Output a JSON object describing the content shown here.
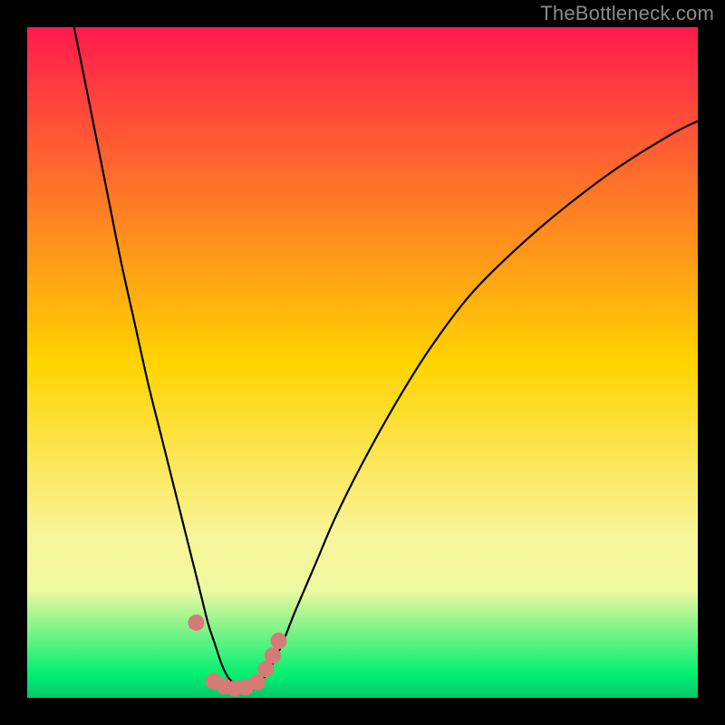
{
  "watermark": "TheBottleneck.com",
  "chart_data": {
    "type": "line",
    "title": "",
    "xlabel": "",
    "ylabel": "",
    "xlim": [
      0,
      100
    ],
    "ylim": [
      0,
      100
    ],
    "grid": false,
    "legend": false,
    "background_gradient": {
      "stops": [
        {
          "offset": 0.0,
          "color": "#ff1a4d"
        },
        {
          "offset": 0.5,
          "color": "#ffd400"
        },
        {
          "offset": 0.76,
          "color": "#f8f59a"
        },
        {
          "offset": 0.84,
          "color": "#edf8a0"
        },
        {
          "offset": 0.965,
          "color": "#00f070"
        },
        {
          "offset": 1.0,
          "color": "#00c86a"
        }
      ]
    },
    "series": [
      {
        "name": "bottleneck-curve",
        "color": "#000000",
        "x": [
          7,
          10,
          12,
          14,
          16,
          18,
          20,
          22,
          24,
          25,
          26,
          27,
          28,
          29,
          30,
          31,
          32,
          33,
          34,
          36,
          38,
          40,
          43,
          46,
          50,
          55,
          60,
          66,
          73,
          80,
          88,
          96,
          100
        ],
        "y": [
          100,
          85,
          75,
          65,
          56,
          47,
          39,
          31,
          23,
          19,
          15,
          11,
          8,
          5,
          3,
          2,
          1.3,
          1.2,
          1.5,
          4,
          8,
          13,
          20,
          27,
          35,
          44,
          52,
          60,
          67,
          73,
          79,
          84,
          86
        ]
      }
    ],
    "markers": {
      "name": "highlight-dots",
      "color": "#d57a74",
      "radius": 9,
      "points": [
        {
          "x": 25.2,
          "y": 11.2
        },
        {
          "x": 27.8,
          "y": 2.5
        },
        {
          "x": 29.4,
          "y": 1.7
        },
        {
          "x": 31.0,
          "y": 1.4
        },
        {
          "x": 32.6,
          "y": 1.6
        },
        {
          "x": 34.3,
          "y": 2.3
        },
        {
          "x": 35.6,
          "y": 4.3
        },
        {
          "x": 36.6,
          "y": 6.3
        },
        {
          "x": 37.5,
          "y": 8.5
        }
      ]
    }
  }
}
